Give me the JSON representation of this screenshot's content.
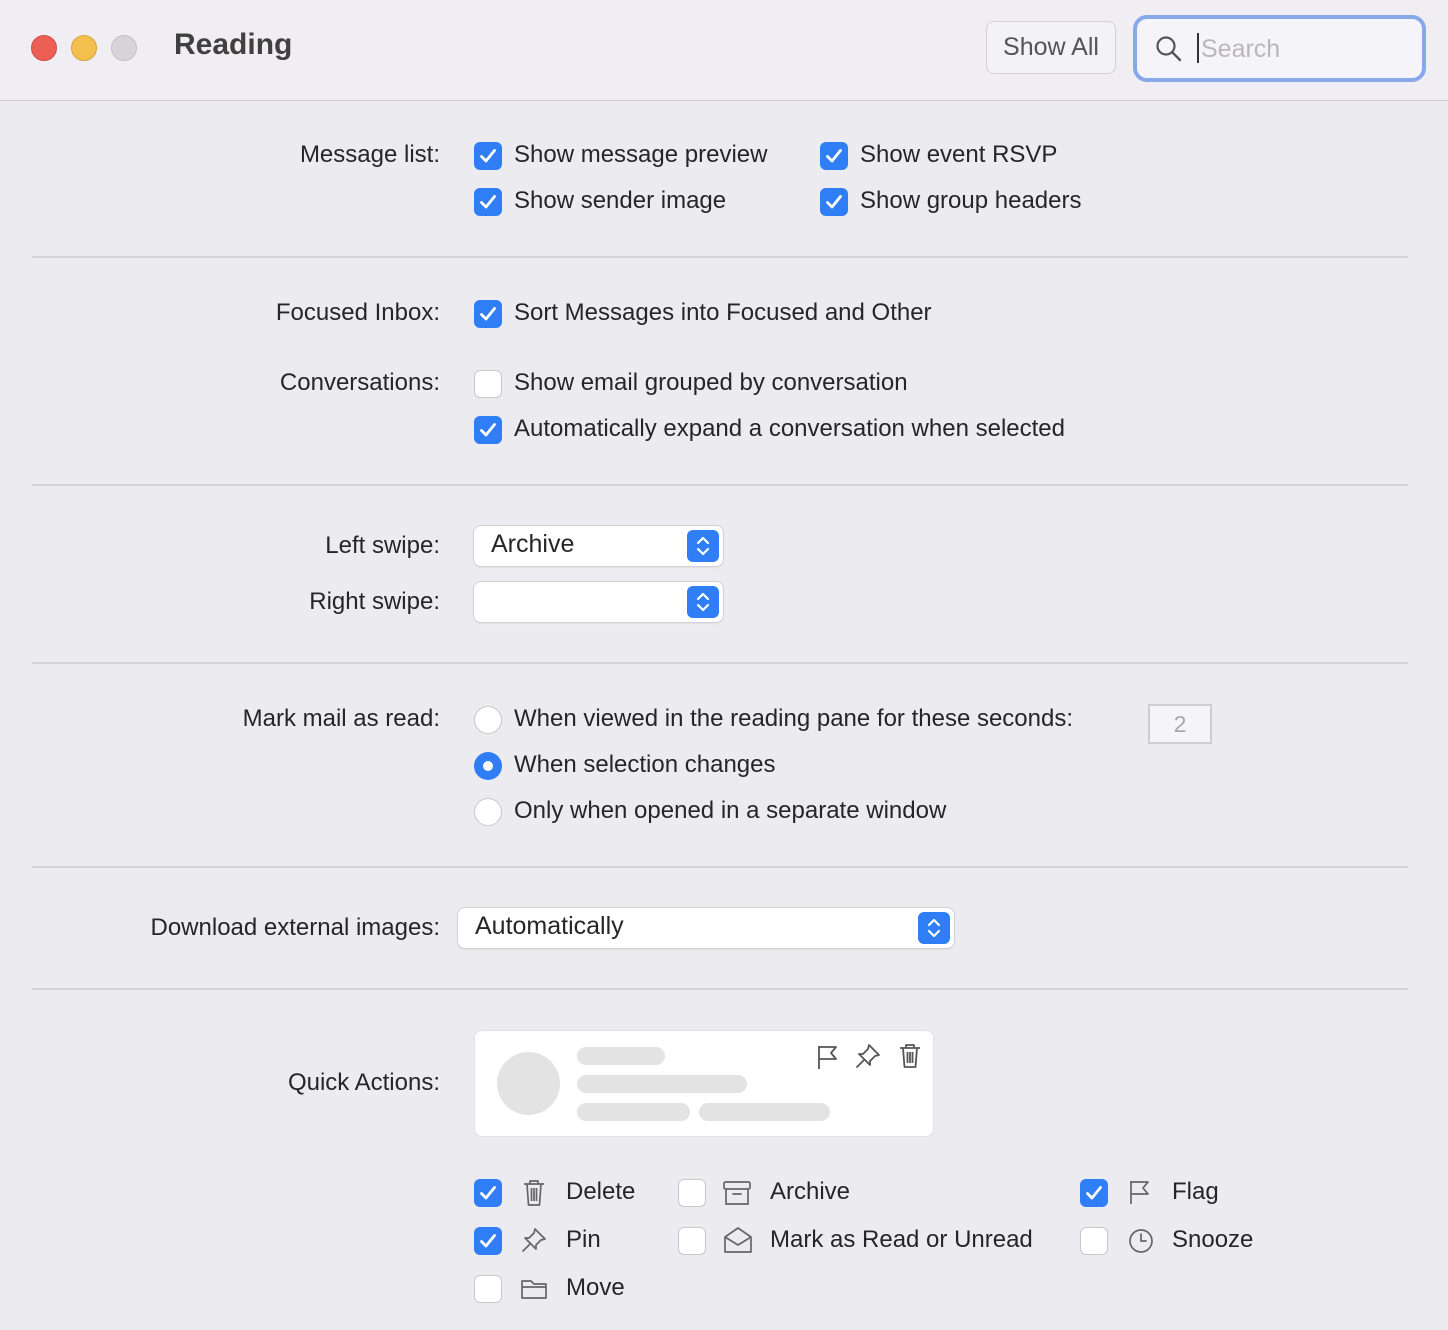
{
  "window": {
    "title": "Reading"
  },
  "toolbar": {
    "show_all": "Show All",
    "search_placeholder": "Search"
  },
  "message_list": {
    "label": "Message list:",
    "options": [
      {
        "label": "Show message preview",
        "checked": true
      },
      {
        "label": "Show event RSVP",
        "checked": true
      },
      {
        "label": "Show sender image",
        "checked": true
      },
      {
        "label": "Show group headers",
        "checked": true
      }
    ]
  },
  "focused_inbox": {
    "label": "Focused Inbox:",
    "option": {
      "label": "Sort Messages into Focused and Other",
      "checked": true
    }
  },
  "conversations": {
    "label": "Conversations:",
    "options": [
      {
        "label": "Show email grouped by conversation",
        "checked": false
      },
      {
        "label": "Automatically expand a conversation when selected",
        "checked": true
      }
    ]
  },
  "swipe": {
    "left_label": "Left swipe:",
    "left_value": "Archive",
    "right_label": "Right swipe:",
    "right_value": ""
  },
  "mark_read": {
    "label": "Mark mail as read:",
    "options": [
      {
        "label": "When viewed in the reading pane for these seconds:",
        "selected": false
      },
      {
        "label": "When selection changes",
        "selected": true
      },
      {
        "label": "Only when opened in a separate window",
        "selected": false
      }
    ],
    "seconds": "2"
  },
  "download_images": {
    "label": "Download external images:",
    "value": "Automatically"
  },
  "quick_actions": {
    "label": "Quick Actions:",
    "preview_icons": [
      "flag-icon",
      "pin-icon",
      "trash-icon"
    ],
    "items": [
      {
        "label": "Delete",
        "checked": true,
        "icon": "trash-icon"
      },
      {
        "label": "Archive",
        "checked": false,
        "icon": "archive-icon"
      },
      {
        "label": "Flag",
        "checked": true,
        "icon": "flag-icon"
      },
      {
        "label": "Pin",
        "checked": true,
        "icon": "pin-icon"
      },
      {
        "label": "Mark as Read or Unread",
        "checked": false,
        "icon": "envelope-open-icon"
      },
      {
        "label": "Snooze",
        "checked": false,
        "icon": "clock-icon"
      },
      {
        "label": "Move",
        "checked": false,
        "icon": "folder-icon"
      }
    ]
  },
  "colors": {
    "accent": "#2f7ef6",
    "background": "#ecebf0",
    "search_focus": "#87a9ea"
  }
}
